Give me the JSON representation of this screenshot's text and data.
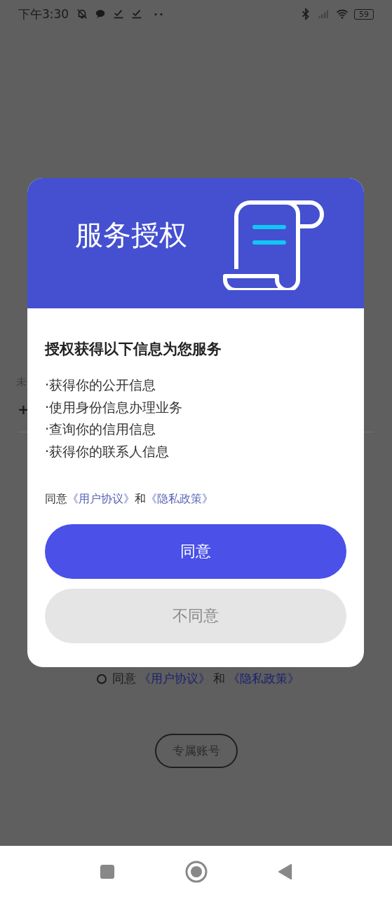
{
  "status_bar": {
    "time": "下午3:30",
    "battery": "59"
  },
  "background": {
    "subtitle": "未",
    "add_symbol": "+",
    "agreement": {
      "checked": false,
      "prefix": "同意",
      "link_1": "《用户协议》",
      "joiner": "和",
      "link_2": "《隐私政策》"
    },
    "account_button": "专属账号"
  },
  "dialog": {
    "title": "服务授权",
    "heading": "授权获得以下信息为您服务",
    "items": [
      "·获得你的公开信息",
      "·使用身份信息办理业务",
      "·查询你的信用信息",
      "·获得你的联系人信息"
    ],
    "agreement": {
      "prefix": "同意",
      "link_1": "《用户协议》",
      "joiner": "和",
      "link_2": "《隐私政策》"
    },
    "buttons": [
      {
        "label": "同意",
        "kind": "primary"
      },
      {
        "label": "不同意",
        "kind": "secondary"
      }
    ]
  }
}
